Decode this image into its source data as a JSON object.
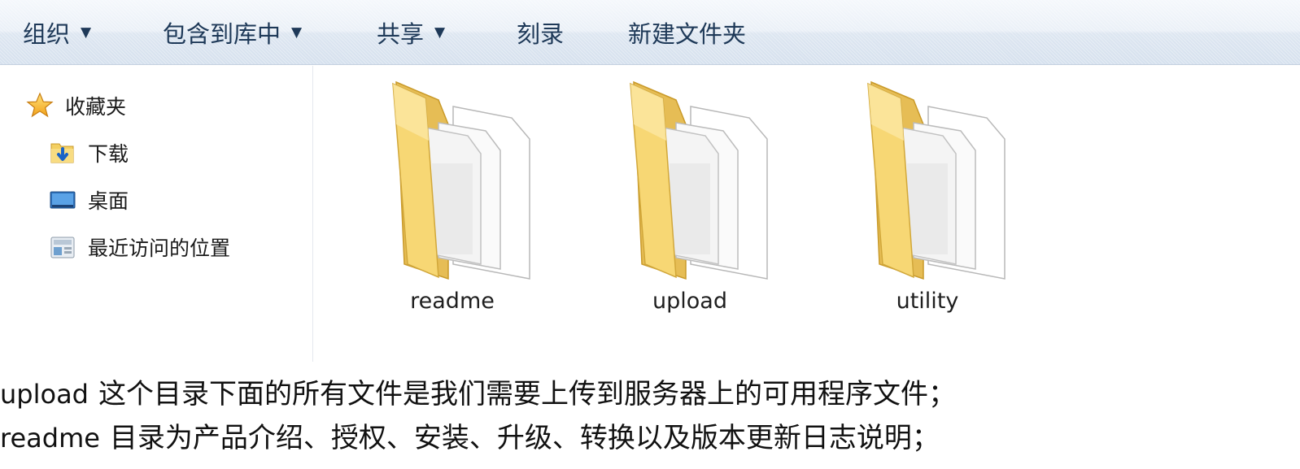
{
  "toolbar": {
    "organize": "组织",
    "include_in_library": "包含到库中",
    "share": "共享",
    "burn": "刻录",
    "new_folder": "新建文件夹"
  },
  "nav": {
    "items": [
      {
        "label": "收藏夹",
        "icon": "star-icon"
      },
      {
        "label": "下载",
        "icon": "downloads-folder-icon"
      },
      {
        "label": "桌面",
        "icon": "desktop-icon"
      },
      {
        "label": "最近访问的位置",
        "icon": "recent-places-icon"
      }
    ]
  },
  "folders": [
    {
      "name": "readme",
      "icon": "folder-icon"
    },
    {
      "name": "upload",
      "icon": "folder-icon"
    },
    {
      "name": "utility",
      "icon": "folder-icon"
    }
  ],
  "notes": [
    {
      "keyword": "upload",
      "text": "这个目录下面的所有文件是我们需要上传到服务器上的可用程序文件；"
    },
    {
      "keyword": "readme",
      "text": "目录为产品介绍、授权、安装、升级、转换以及版本更新日志说明；"
    }
  ],
  "colors": {
    "toolbar_text": "#1e3958",
    "folder_fill": "#f7d774",
    "folder_back": "#e9c25a"
  }
}
